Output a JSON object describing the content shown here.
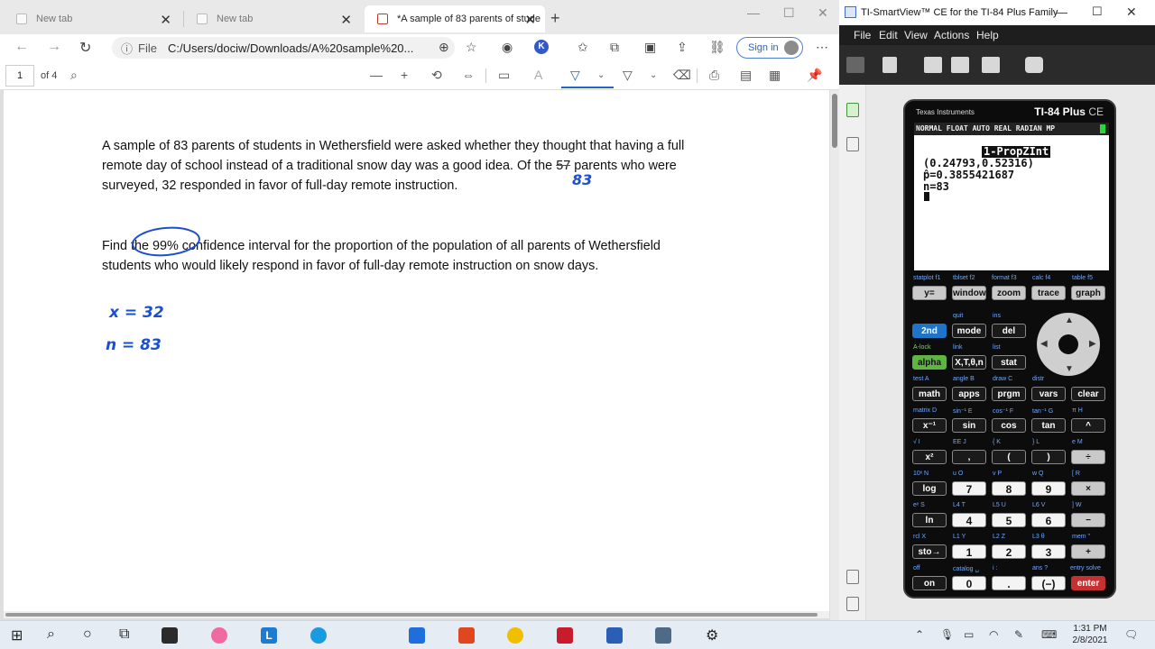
{
  "browser": {
    "tabs": [
      {
        "title": "New tab"
      },
      {
        "title": "New tab"
      },
      {
        "title": "*A sample of 83 parents of stude"
      }
    ],
    "url_scheme": "File",
    "url": "C:/Users/dociw/Downloads/A%20sample%20...",
    "signin_label": "Sign in",
    "pdf": {
      "page_number": "1",
      "page_of": "of 4"
    }
  },
  "document": {
    "para1_line1": "A sample of 83 parents of students in Wethersfield were asked whether they thought that having a full",
    "para1_line2_pre": "remote day of school instead of a traditional snow day was a good idea. Of the ",
    "para1_line2_struck": "57",
    "para1_line2_post": " parents who were",
    "para1_line3": "surveyed, 32 responded in favor of full-day remote instruction.",
    "para2_line1": "Find the 99% confidence interval for the proportion of the population of all parents of Wethersfield",
    "para2_line2": "students who would likely respond in favor of full-day remote instruction on snow days.",
    "ink_correction": "83",
    "ink_x": "x = 32",
    "ink_n": "n = 83"
  },
  "smartview": {
    "window_title": "TI-SmartView™ CE for the TI-84 Plus Family",
    "menu": [
      "File",
      "Edit",
      "View",
      "Actions",
      "Help"
    ],
    "calc": {
      "brand": "Texas Instruments",
      "model": "TI-84 Plus",
      "model_suffix": "CE",
      "status": "NORMAL FLOAT AUTO REAL RADIAN MP",
      "screen_header": "1-PropZInt",
      "screen_lines": [
        "(0.24793,0.52316)",
        "p̂=0.3855421687",
        "n=83"
      ],
      "keys": {
        "r1": [
          "y=",
          "window",
          "zoom",
          "trace",
          "graph"
        ],
        "r2": [
          "2nd",
          "mode",
          "del"
        ],
        "r3": [
          "alpha",
          "X,T,θ,n",
          "stat"
        ],
        "r4": [
          "math",
          "apps",
          "prgm",
          "vars",
          "clear"
        ],
        "r5": [
          "x⁻¹",
          "sin",
          "cos",
          "tan",
          "^"
        ],
        "r6": [
          "x²",
          ",",
          "(",
          ")",
          "÷"
        ],
        "r7": [
          "log",
          "7",
          "8",
          "9",
          "×"
        ],
        "r8": [
          "ln",
          "4",
          "5",
          "6",
          "−"
        ],
        "r9": [
          "sto→",
          "1",
          "2",
          "3",
          "+"
        ],
        "r10": [
          "on",
          "0",
          ".",
          "(−)",
          "enter"
        ]
      },
      "labels": {
        "r1": [
          "statplot  f1",
          "tblset  f2",
          "format  f3",
          "calc  f4",
          "table  f5"
        ],
        "r2": [
          "quit",
          "ins"
        ],
        "r3": [
          "A-lock",
          "link",
          "list"
        ],
        "r4": [
          "test  A",
          "angle  B",
          "draw  C",
          "distr"
        ],
        "r5": [
          "matrix  D",
          "sin⁻¹  E",
          "cos⁻¹  F",
          "tan⁻¹  G",
          "π  H"
        ],
        "r6": [
          "√  I",
          "EE  J",
          "{  K",
          "}  L",
          "e  M"
        ],
        "r7": [
          "10ˣ  N",
          "u  O",
          "v  P",
          "w  Q",
          "[  R"
        ],
        "r8": [
          "eˣ  S",
          "L4  T",
          "L5  U",
          "L6  V",
          "]  W"
        ],
        "r9": [
          "rcl  X",
          "L1  Y",
          "L2  Z",
          "L3  θ",
          "mem  \""
        ],
        "r10": [
          "off",
          "catalog  ␣",
          "i  :",
          "ans  ?",
          "entry solve"
        ]
      }
    }
  },
  "taskbar": {
    "time": "1:31 PM",
    "date": "2/8/2021"
  }
}
